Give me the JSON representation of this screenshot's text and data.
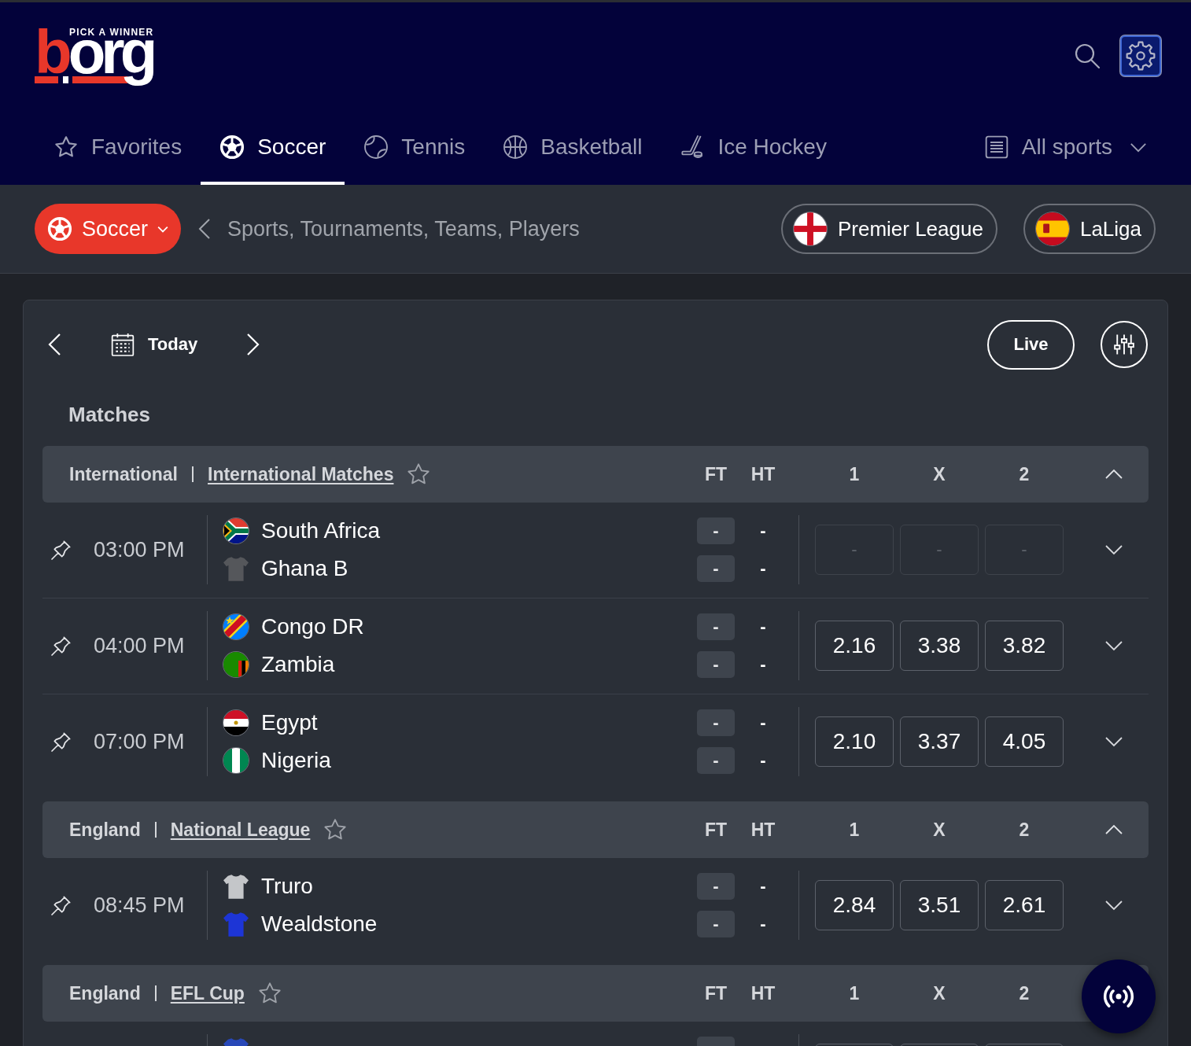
{
  "header": {
    "logo": {
      "tagline": "PICK A WINNER",
      "wordmark": [
        {
          "text": "b",
          "color": "#e8372a"
        },
        {
          "text": "org",
          "color": "#ffffff"
        }
      ]
    }
  },
  "nav": {
    "tabs": [
      {
        "label": "Favorites",
        "selected": false
      },
      {
        "label": "Soccer",
        "selected": true
      },
      {
        "label": "Tennis",
        "selected": false
      },
      {
        "label": "Basketball",
        "selected": false
      },
      {
        "label": "Ice Hockey",
        "selected": false
      }
    ],
    "all_sports": {
      "label": "All sports",
      "expanded": false
    }
  },
  "filter_bar": {
    "sport_picker": {
      "label": "Soccer",
      "expanded": false
    },
    "search": {
      "placeholder": "Sports, Tournaments, Teams, Players"
    },
    "quick_links": [
      {
        "label": "Premier League"
      },
      {
        "label": "LaLiga"
      }
    ]
  },
  "date_nav": {
    "label": "Today"
  },
  "live_button": {
    "label": "Live"
  },
  "section_title": "Matches",
  "groups": [
    {
      "country": "International",
      "competition": "International Matches",
      "favorite": false,
      "expanded": true,
      "columns": [
        "FT",
        "HT",
        "1",
        "X",
        "2"
      ],
      "matches": [
        {
          "time": "03:00 PM",
          "expanded": false,
          "teams": [
            {
              "name": "South Africa",
              "kind": "flag",
              "ft": "-",
              "ht": "-"
            },
            {
              "name": "Ghana B",
              "kind": "shirt",
              "color": "#55575b",
              "ft": "-",
              "ht": "-"
            }
          ],
          "odds": [
            {
              "value": "-",
              "disabled": true
            },
            {
              "value": "-",
              "disabled": true
            },
            {
              "value": "-",
              "disabled": true
            }
          ]
        },
        {
          "time": "04:00 PM",
          "expanded": false,
          "teams": [
            {
              "name": "Congo DR",
              "kind": "flag",
              "ft": "-",
              "ht": "-"
            },
            {
              "name": "Zambia",
              "kind": "flag",
              "ft": "-",
              "ht": "-"
            }
          ],
          "odds": [
            {
              "value": "2.16",
              "disabled": false
            },
            {
              "value": "3.38",
              "disabled": false
            },
            {
              "value": "3.82",
              "disabled": false
            }
          ]
        },
        {
          "time": "07:00 PM",
          "expanded": false,
          "teams": [
            {
              "name": "Egypt",
              "kind": "flag",
              "ft": "-",
              "ht": "-"
            },
            {
              "name": "Nigeria",
              "kind": "flag",
              "ft": "-",
              "ht": "-"
            }
          ],
          "odds": [
            {
              "value": "2.10",
              "disabled": false
            },
            {
              "value": "3.37",
              "disabled": false
            },
            {
              "value": "4.05",
              "disabled": false
            }
          ]
        }
      ]
    },
    {
      "country": "England",
      "competition": "National League",
      "favorite": false,
      "expanded": true,
      "columns": [
        "FT",
        "HT",
        "1",
        "X",
        "2"
      ],
      "matches": [
        {
          "time": "08:45 PM",
          "expanded": false,
          "teams": [
            {
              "name": "Truro",
              "kind": "shirt",
              "color": "#c4c6c9",
              "ft": "-",
              "ht": "-"
            },
            {
              "name": "Wealdstone",
              "kind": "shirt",
              "color": "#1d35d6",
              "ft": "-",
              "ht": "-"
            }
          ],
          "odds": [
            {
              "value": "2.84",
              "disabled": false
            },
            {
              "value": "3.51",
              "disabled": false
            },
            {
              "value": "2.61",
              "disabled": false
            }
          ]
        }
      ]
    },
    {
      "country": "England",
      "competition": "EFL Cup",
      "favorite": false,
      "columns": [
        "FT",
        "HT",
        "1",
        "X",
        "2"
      ],
      "matches": [
        {
          "teams": [
            {
              "kind": "shirt",
              "color": "#2848b8"
            }
          ],
          "odds": [
            {
              "disabled": false
            },
            {
              "disabled": false
            },
            {
              "disabled": false
            }
          ]
        }
      ]
    }
  ]
}
